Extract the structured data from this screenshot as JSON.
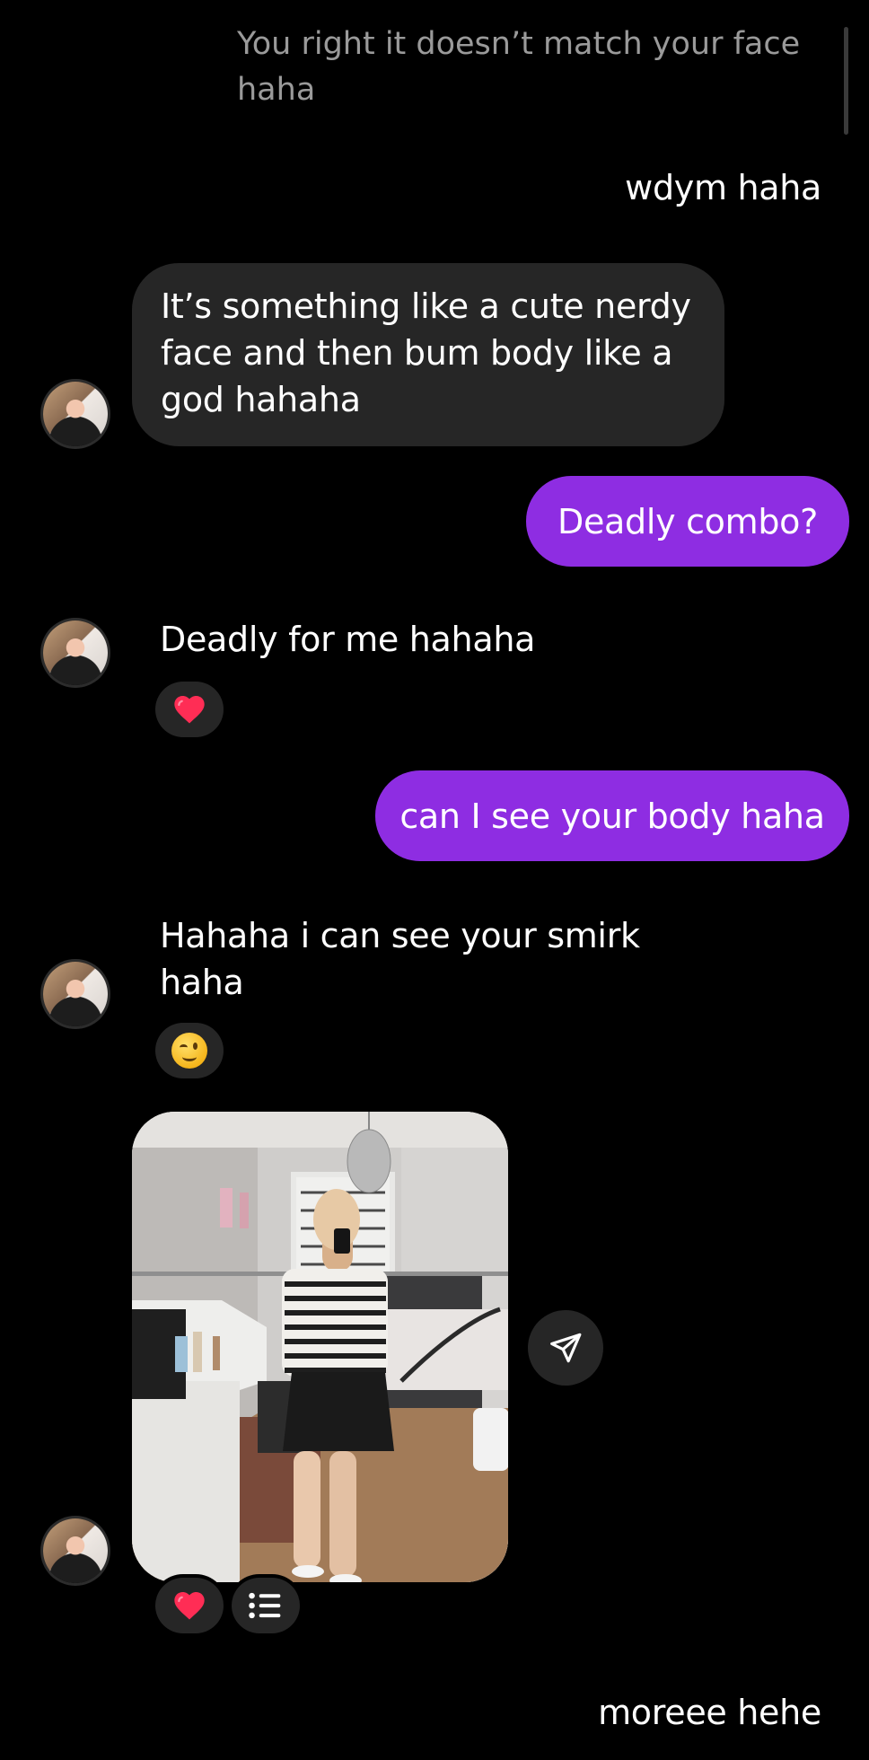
{
  "messages": {
    "quoted_text": "You right it doesn’t match your face haha",
    "m1_out": "wdym haha",
    "m2_in": "It’s something like a cute nerdy face and then bum body like a god hahaha",
    "m3_out": "Deadly combo?",
    "m4_in": "Deadly for me hahaha",
    "m5_out": "can I see your body haha",
    "m6_in": "Hahaha i can see your smirk haha",
    "m8_out": "moreee hehe"
  },
  "reactions": {
    "m4": "heart-emoji",
    "m6": "winking-face-emoji",
    "m7": [
      "heart-emoji",
      "list-icon"
    ]
  },
  "colors": {
    "background": "#000000",
    "incoming_bubble": "#262626",
    "outgoing_bubble": "#8e2de2",
    "quoted_text": "#9a9a9a",
    "heart": "#ff2d55"
  },
  "icons": {
    "share": "paper-plane-icon",
    "avatar": "contact-avatar"
  }
}
